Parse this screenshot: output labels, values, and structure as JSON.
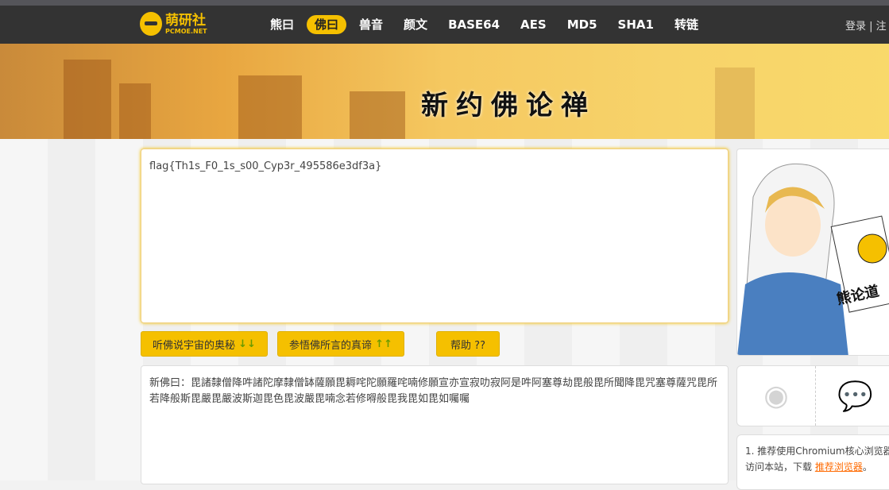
{
  "logo": {
    "name": "萌研社",
    "sub": "PCMOE.NET"
  },
  "nav": {
    "items": [
      "熊曰",
      "佛曰",
      "兽音",
      "颜文",
      "BASE64",
      "AES",
      "MD5",
      "SHA1",
      "转链"
    ],
    "active": 1,
    "login": "登录",
    "register": "注"
  },
  "banner": {
    "title": "新约佛论禅"
  },
  "input": {
    "value": "flag{Th1s_F0_1s_s00_Cyp3r_495586e3df3a}"
  },
  "buttons": {
    "encode": "听佛说宇宙的奥秘",
    "encode_arrows": "↓↓",
    "decode": "参悟佛所言的真谛",
    "decode_arrows": "↑↑",
    "help": "帮助 ??"
  },
  "output": {
    "value": "新佛曰：毘諸隸僧降吽諸陀摩隸僧缽薩願毘耨咤陀願羅咤喃修願宣亦宣寂叻寂阿是吽阿塞尊劫毘般毘所聞降毘咒塞尊薩咒毘所若降般斯毘嚴毘嚴波斯迦毘色毘波嚴毘喃念若修嘚般毘我毘如毘如囑囑"
  },
  "sidebar": {
    "poster_text": "熊论道",
    "tip_line1": "1. 推荐使用Chromium核心浏览器",
    "tip_line2": "访问本站，下载 ",
    "tip_link": "推荐浏览器",
    "tip_end": "。"
  }
}
